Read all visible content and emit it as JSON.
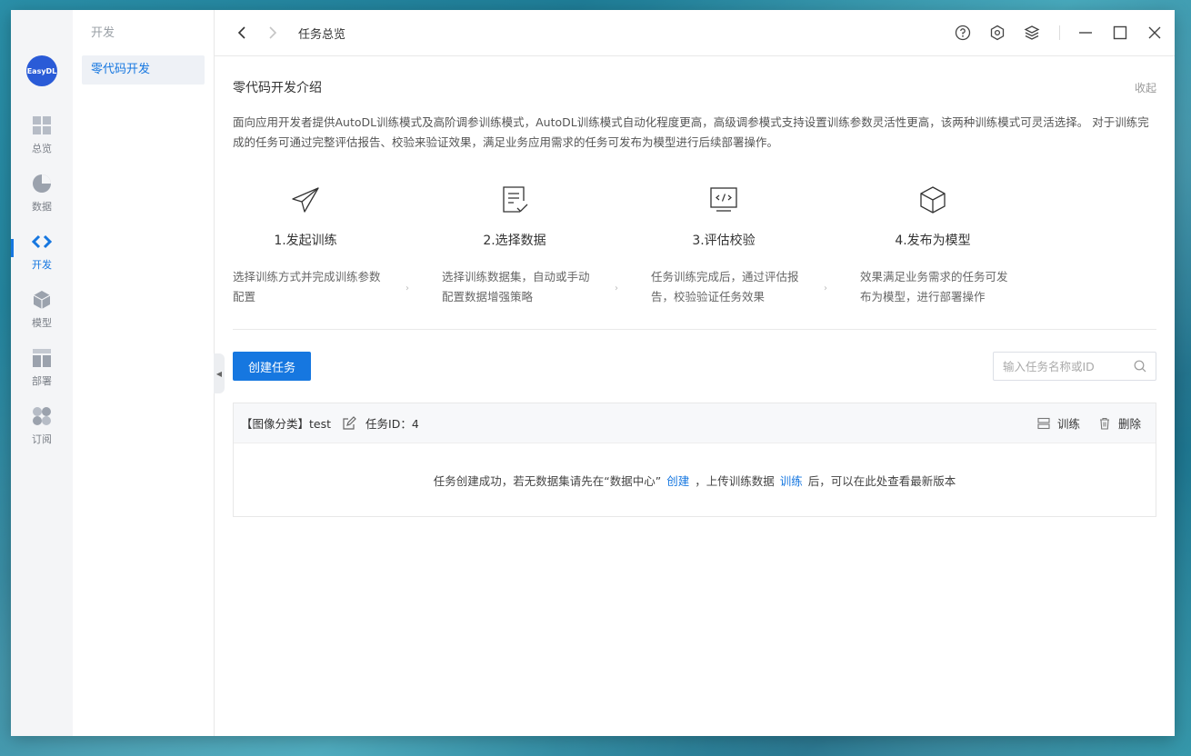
{
  "rail": {
    "logo_text": "EasyDL",
    "items": [
      {
        "label": "总览",
        "icon": "overview-icon"
      },
      {
        "label": "数据",
        "icon": "data-icon"
      },
      {
        "label": "开发",
        "icon": "develop-icon"
      },
      {
        "label": "模型",
        "icon": "model-icon"
      },
      {
        "label": "部署",
        "icon": "deploy-icon"
      },
      {
        "label": "订阅",
        "icon": "subscribe-icon"
      }
    ],
    "active": "开发"
  },
  "subnav": {
    "title": "开发",
    "item": "零代码开发"
  },
  "topbar": {
    "breadcrumb": "任务总览"
  },
  "intro": {
    "title": "零代码开发介绍",
    "collapse": "收起",
    "description": "面向应用开发者提供AutoDL训练模式及高阶调参训练模式，AutoDL训练模式自动化程度更高，高级调参模式支持设置训练参数灵活性更高，该两种训练模式可灵活选择。 对于训练完成的任务可通过完整评估报告、校验来验证效果，满足业务应用需求的任务可发布为模型进行后续部署操作。"
  },
  "steps": [
    {
      "title": "1.发起训练",
      "desc": "选择训练方式并完成训练参数配置",
      "icon": "paper-plane-icon"
    },
    {
      "title": "2.选择数据",
      "desc": "选择训练数据集，自动或手动配置数据增强策略",
      "icon": "checklist-icon"
    },
    {
      "title": "3.评估校验",
      "desc": "任务训练完成后，通过评估报告，校验验证任务效果",
      "icon": "code-monitor-icon"
    },
    {
      "title": "4.发布为模型",
      "desc": "效果满足业务需求的任务可发布为模型，进行部署操作",
      "icon": "cube-icon"
    }
  ],
  "actions": {
    "create_button": "创建任务",
    "search_placeholder": "输入任务名称或ID"
  },
  "task": {
    "name": "【图像分类】test",
    "id_label": "任务ID：4",
    "train_label": "训练",
    "delete_label": "删除",
    "msg_part1": "任务创建成功，若无数据集请先在“数据中心”",
    "link_create": "创建",
    "msg_part2": "，上传训练数据",
    "link_train": "训练",
    "msg_part3": "后，可以在此处查看最新版本"
  },
  "colors": {
    "accent": "#1677e0",
    "logo_bg": "#2a5bd7"
  }
}
